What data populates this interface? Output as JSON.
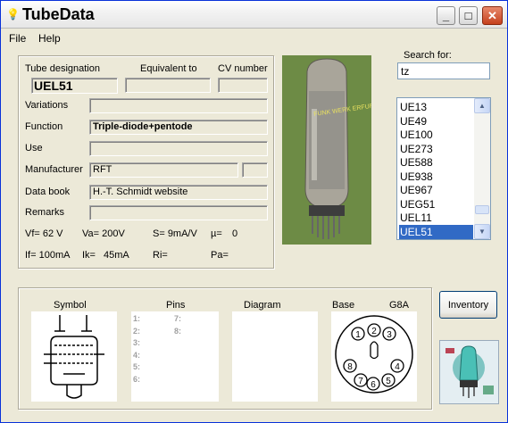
{
  "window": {
    "title": "TubeData",
    "icon": "lightbulb-icon"
  },
  "menu": {
    "file": "File",
    "help": "Help"
  },
  "labels": {
    "tube_designation": "Tube designation",
    "equivalent_to": "Equivalent to",
    "cv_number": "CV number",
    "variations": "Variations",
    "function": "Function",
    "use": "Use",
    "manufacturer": "Manufacturer",
    "data_book": "Data book",
    "remarks": "Remarks"
  },
  "values": {
    "tube_designation": "UEL51",
    "equivalent_to": "",
    "cv_number": "",
    "variations": "",
    "function": "Triple-diode+pentode",
    "use": "",
    "manufacturer": "RFT",
    "manufacturer_extra": "",
    "data_book": "H.-T. Schmidt website",
    "remarks": ""
  },
  "params": {
    "vf": "Vf= 62 V",
    "va": "Va= 200V",
    "s": "S= 9mA/V",
    "mu": "µ=",
    "mu_val": "0",
    "if": "If= 100mA",
    "ik": "Ik=",
    "ik_val": "45mA",
    "ri": "Ri=",
    "pa": "Pa="
  },
  "search": {
    "label": "Search for:",
    "value": "tz"
  },
  "tube_list": {
    "items": [
      "UE13",
      "UE49",
      "UE100",
      "UE273",
      "UE588",
      "UE938",
      "UE967",
      "UEG51",
      "UEL11",
      "UEL51"
    ],
    "selected": "UEL51"
  },
  "bottom": {
    "symbol": "Symbol",
    "pins": "Pins",
    "diagram": "Diagram",
    "base": "Base",
    "base_type": "G8A"
  },
  "pins": {
    "left": [
      "1:",
      "2:",
      "3:",
      "4:",
      "5:",
      "6:"
    ],
    "right": [
      "7:",
      "8:"
    ]
  },
  "base_pins": [
    "1",
    "2",
    "3",
    "4",
    "5",
    "6",
    "7",
    "8"
  ],
  "inventory_button": "Inventory",
  "photo_label": "FUNK WERK ERFURT UEL51"
}
